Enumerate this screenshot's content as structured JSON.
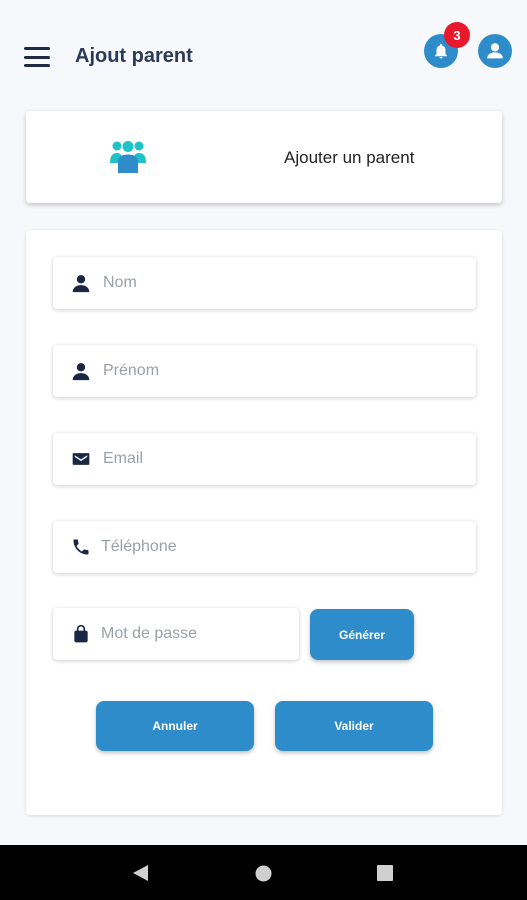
{
  "appbar": {
    "title": "Ajout parent",
    "notification_count": "3"
  },
  "header_card": {
    "title": "Ajouter un parent",
    "icon": "group-icon"
  },
  "form": {
    "nom": {
      "placeholder": "Nom",
      "icon": "person-icon"
    },
    "prenom": {
      "placeholder": "Prénom",
      "icon": "person-icon"
    },
    "email": {
      "placeholder": "Email",
      "icon": "mail-icon"
    },
    "telephone": {
      "placeholder": "Téléphone",
      "icon": "phone-icon"
    },
    "password": {
      "placeholder": "Mot de passe",
      "icon": "lock-icon"
    },
    "generate_label": "Générer",
    "cancel_label": "Annuler",
    "submit_label": "Valider"
  },
  "colors": {
    "primary": "#2f8ccb",
    "badge": "#e8192c",
    "group_icon": "#1ec2c9",
    "background": "#f6f8fc"
  }
}
